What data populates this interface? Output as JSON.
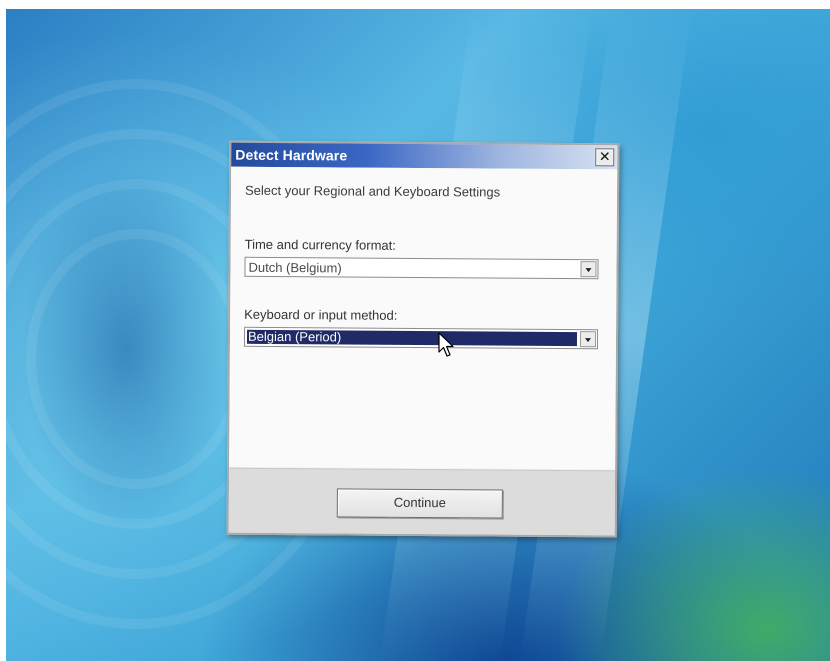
{
  "window": {
    "title": "Detect Hardware",
    "close_glyph": "✕"
  },
  "dialog": {
    "heading": "Select your Regional and Keyboard Settings",
    "time_format": {
      "label": "Time and currency format:",
      "selected": "Dutch (Belgium)"
    },
    "keyboard": {
      "label": "Keyboard or input method:",
      "selected": "Belgian (Period)"
    },
    "continue_label": "Continue"
  },
  "icons": {
    "close": "close-icon",
    "dropdown": "chevron-down-icon",
    "pointer": "mouse-pointer-icon"
  },
  "colors": {
    "title_bar_start": "#244a9c",
    "selection": "#1f2a66"
  }
}
